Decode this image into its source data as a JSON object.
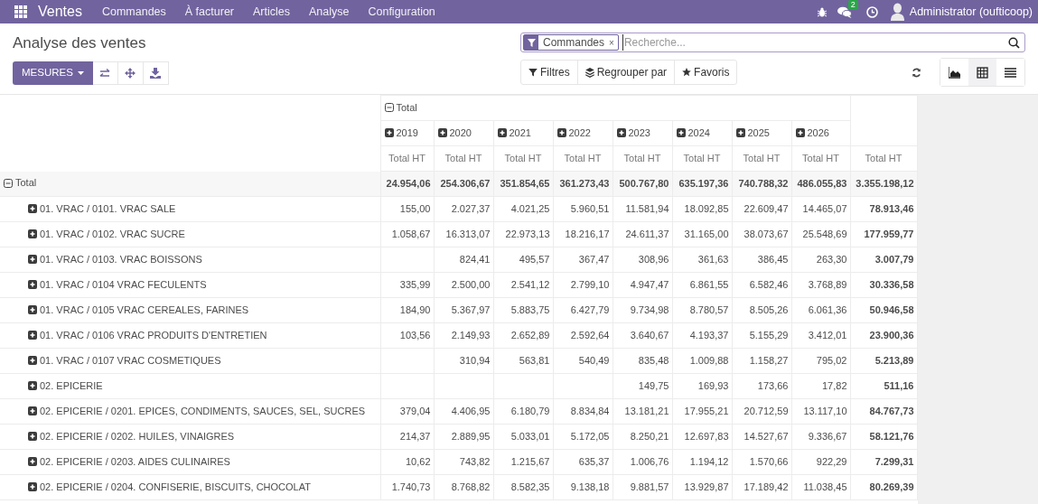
{
  "navbar": {
    "app": "Ventes",
    "menus": [
      "Commandes",
      "À facturer",
      "Articles",
      "Analyse",
      "Configuration"
    ],
    "message_count": "2",
    "user": "Administrator (oufticoop)"
  },
  "title": "Analyse des ventes",
  "measures_button": "MESURES",
  "search": {
    "facet": "Commandes",
    "facet_remove": "×",
    "placeholder": "Recherche..."
  },
  "filters": [
    {
      "kind": "filter",
      "label": "Filtres"
    },
    {
      "kind": "group",
      "label": "Regrouper par"
    },
    {
      "kind": "favorite",
      "label": "Favoris"
    }
  ],
  "views": [
    {
      "kind": "graph",
      "selected": false
    },
    {
      "kind": "pivot",
      "selected": true
    },
    {
      "kind": "list",
      "selected": false
    }
  ],
  "pivot": {
    "column_header": {
      "label": "Total",
      "expanded": true
    },
    "years": [
      {
        "label": "2019",
        "expanded": false
      },
      {
        "label": "2020",
        "expanded": false
      },
      {
        "label": "2021",
        "expanded": false
      },
      {
        "label": "2022",
        "expanded": false
      },
      {
        "label": "2023",
        "expanded": false
      },
      {
        "label": "2024",
        "expanded": false
      },
      {
        "label": "2025",
        "expanded": false
      },
      {
        "label": "2026",
        "expanded": false
      }
    ],
    "measures": [
      "Total HT",
      "Total HT",
      "Total HT",
      "Total HT",
      "Total HT",
      "Total HT",
      "Total HT",
      "Total HT",
      "Total HT"
    ],
    "total_row": {
      "label": "Total",
      "expanded": true,
      "cells": [
        {
          "value": "24.954,06"
        },
        {
          "value": "254.306,67"
        },
        {
          "value": "351.854,65"
        },
        {
          "value": "361.273,43"
        },
        {
          "value": "500.767,80"
        },
        {
          "value": "635.197,36"
        },
        {
          "value": "740.788,32"
        },
        {
          "value": "486.055,83"
        }
      ],
      "total": "3.355.198,12"
    },
    "rows": [
      {
        "label": "01. VRAC / 0101. VRAC SALE",
        "expanded": false,
        "cells": [
          {
            "value": "155,00"
          },
          {
            "value": "2.027,37"
          },
          {
            "value": "4.021,25"
          },
          {
            "value": "5.960,51"
          },
          {
            "value": "11.581,94"
          },
          {
            "value": "18.092,85"
          },
          {
            "value": "22.609,47"
          },
          {
            "value": "14.465,07"
          }
        ],
        "total": "78.913,46"
      },
      {
        "label": "01. VRAC / 0102. VRAC SUCRE",
        "expanded": false,
        "cells": [
          {
            "value": "1.058,67"
          },
          {
            "value": "16.313,07"
          },
          {
            "value": "22.973,13"
          },
          {
            "value": "18.216,17"
          },
          {
            "value": "24.611,37"
          },
          {
            "value": "31.165,00"
          },
          {
            "value": "38.073,67"
          },
          {
            "value": "25.548,69"
          }
        ],
        "total": "177.959,77"
      },
      {
        "label": "01. VRAC / 0103. VRAC BOISSONS",
        "expanded": false,
        "cells": [
          {
            "empty": true
          },
          {
            "value": "824,41"
          },
          {
            "value": "495,57"
          },
          {
            "value": "367,47"
          },
          {
            "value": "308,96"
          },
          {
            "value": "361,63"
          },
          {
            "value": "386,45"
          },
          {
            "value": "263,30"
          }
        ],
        "total": "3.007,79"
      },
      {
        "label": "01. VRAC / 0104 VRAC FECULENTS",
        "expanded": false,
        "cells": [
          {
            "value": "335,99"
          },
          {
            "value": "2.500,00"
          },
          {
            "value": "2.541,12"
          },
          {
            "value": "2.799,10"
          },
          {
            "value": "4.947,47"
          },
          {
            "value": "6.861,55"
          },
          {
            "value": "6.582,46"
          },
          {
            "value": "3.768,89"
          }
        ],
        "total": "30.336,58"
      },
      {
        "label": "01. VRAC / 0105 VRAC CEREALES, FARINES",
        "expanded": false,
        "cells": [
          {
            "value": "184,90"
          },
          {
            "value": "5.367,97"
          },
          {
            "value": "5.883,75"
          },
          {
            "value": "6.427,79"
          },
          {
            "value": "9.734,98"
          },
          {
            "value": "8.780,57"
          },
          {
            "value": "8.505,26"
          },
          {
            "value": "6.061,36"
          }
        ],
        "total": "50.946,58"
      },
      {
        "label": "01. VRAC / 0106 VRAC PRODUITS D'ENTRETIEN",
        "expanded": false,
        "cells": [
          {
            "value": "103,56"
          },
          {
            "value": "2.149,93"
          },
          {
            "value": "2.652,89"
          },
          {
            "value": "2.592,64"
          },
          {
            "value": "3.640,67"
          },
          {
            "value": "4.193,37"
          },
          {
            "value": "5.155,29"
          },
          {
            "value": "3.412,01"
          }
        ],
        "total": "23.900,36"
      },
      {
        "label": "01. VRAC / 0107 VRAC COSMETIQUES",
        "expanded": false,
        "cells": [
          {
            "empty": true
          },
          {
            "value": "310,94"
          },
          {
            "value": "563,81"
          },
          {
            "value": "540,49"
          },
          {
            "value": "835,48"
          },
          {
            "value": "1.009,88"
          },
          {
            "value": "1.158,27"
          },
          {
            "value": "795,02"
          }
        ],
        "total": "5.213,89"
      },
      {
        "label": "02. EPICERIE",
        "expanded": false,
        "cells": [
          {
            "empty": true
          },
          {
            "empty": true
          },
          {
            "empty": true
          },
          {
            "empty": true
          },
          {
            "value": "149,75"
          },
          {
            "value": "169,93"
          },
          {
            "value": "173,66"
          },
          {
            "value": "17,82"
          }
        ],
        "total": "511,16"
      },
      {
        "label": "02. EPICERIE / 0201. EPICES, CONDIMENTS, SAUCES, SEL, SUCRES",
        "expanded": false,
        "cells": [
          {
            "value": "379,04"
          },
          {
            "value": "4.406,95"
          },
          {
            "value": "6.180,79"
          },
          {
            "value": "8.834,84"
          },
          {
            "value": "13.181,21"
          },
          {
            "value": "17.955,21"
          },
          {
            "value": "20.712,59"
          },
          {
            "value": "13.117,10"
          }
        ],
        "total": "84.767,73"
      },
      {
        "label": "02. EPICERIE / 0202. HUILES, VINAIGRES",
        "expanded": false,
        "cells": [
          {
            "value": "214,37"
          },
          {
            "value": "2.889,95"
          },
          {
            "value": "5.033,01"
          },
          {
            "value": "5.172,05"
          },
          {
            "value": "8.250,21"
          },
          {
            "value": "12.697,83"
          },
          {
            "value": "14.527,67"
          },
          {
            "value": "9.336,67"
          }
        ],
        "total": "58.121,76"
      },
      {
        "label": "02. EPICERIE / 0203. AIDES CULINAIRES",
        "expanded": false,
        "cells": [
          {
            "value": "10,62"
          },
          {
            "value": "743,82"
          },
          {
            "value": "1.215,67"
          },
          {
            "value": "635,37"
          },
          {
            "value": "1.006,76"
          },
          {
            "value": "1.194,12"
          },
          {
            "value": "1.570,66"
          },
          {
            "value": "922,29"
          }
        ],
        "total": "7.299,31"
      },
      {
        "label": "02. EPICERIE / 0204. CONFISERIE, BISCUITS, CHOCOLAT",
        "expanded": false,
        "cells": [
          {
            "value": "1.740,73"
          },
          {
            "value": "8.768,82"
          },
          {
            "value": "8.582,35"
          },
          {
            "value": "9.138,18"
          },
          {
            "value": "9.881,57"
          },
          {
            "value": "13.929,87"
          },
          {
            "value": "17.189,42"
          },
          {
            "value": "11.038,45"
          }
        ],
        "total": "80.269,39"
      }
    ]
  }
}
